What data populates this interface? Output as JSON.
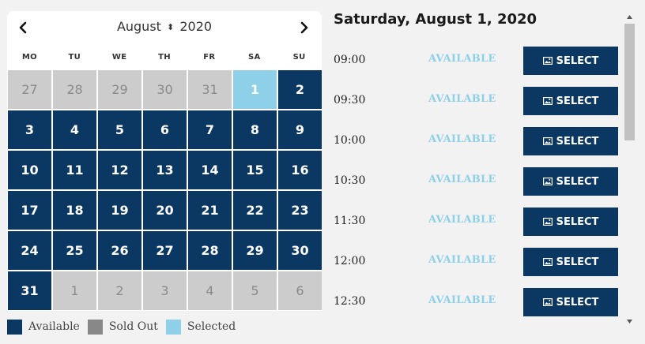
{
  "calendar": {
    "month": "August",
    "year": "2020",
    "month_toggle_glyph": "⬍",
    "prev_icon": "chevron-left-icon",
    "next_icon": "chevron-right-icon",
    "weekdays": [
      "MO",
      "TU",
      "WE",
      "TH",
      "FR",
      "SA",
      "SU"
    ],
    "weeks": [
      [
        {
          "day": "27",
          "state": "disabled"
        },
        {
          "day": "28",
          "state": "disabled"
        },
        {
          "day": "29",
          "state": "disabled"
        },
        {
          "day": "30",
          "state": "disabled"
        },
        {
          "day": "31",
          "state": "disabled"
        },
        {
          "day": "1",
          "state": "selected"
        },
        {
          "day": "2",
          "state": "available"
        }
      ],
      [
        {
          "day": "3",
          "state": "available"
        },
        {
          "day": "4",
          "state": "available"
        },
        {
          "day": "5",
          "state": "available"
        },
        {
          "day": "6",
          "state": "available"
        },
        {
          "day": "7",
          "state": "available"
        },
        {
          "day": "8",
          "state": "available"
        },
        {
          "day": "9",
          "state": "available"
        }
      ],
      [
        {
          "day": "10",
          "state": "available"
        },
        {
          "day": "11",
          "state": "available"
        },
        {
          "day": "12",
          "state": "available"
        },
        {
          "day": "13",
          "state": "available"
        },
        {
          "day": "14",
          "state": "available"
        },
        {
          "day": "15",
          "state": "available"
        },
        {
          "day": "16",
          "state": "available"
        }
      ],
      [
        {
          "day": "17",
          "state": "available"
        },
        {
          "day": "18",
          "state": "available"
        },
        {
          "day": "19",
          "state": "available"
        },
        {
          "day": "20",
          "state": "available"
        },
        {
          "day": "21",
          "state": "available"
        },
        {
          "day": "22",
          "state": "available"
        },
        {
          "day": "23",
          "state": "available"
        }
      ],
      [
        {
          "day": "24",
          "state": "available"
        },
        {
          "day": "25",
          "state": "available"
        },
        {
          "day": "26",
          "state": "available"
        },
        {
          "day": "27",
          "state": "available"
        },
        {
          "day": "28",
          "state": "available"
        },
        {
          "day": "29",
          "state": "available"
        },
        {
          "day": "30",
          "state": "available"
        }
      ],
      [
        {
          "day": "31",
          "state": "available"
        },
        {
          "day": "1",
          "state": "disabled"
        },
        {
          "day": "2",
          "state": "disabled"
        },
        {
          "day": "3",
          "state": "disabled"
        },
        {
          "day": "4",
          "state": "disabled"
        },
        {
          "day": "5",
          "state": "disabled"
        },
        {
          "day": "6",
          "state": "disabled"
        }
      ]
    ]
  },
  "legend": [
    {
      "label": "Available",
      "color": "#0b3763"
    },
    {
      "label": "Sold Out",
      "color": "#888888"
    },
    {
      "label": "Selected",
      "color": "#8dd0e8"
    }
  ],
  "day_title": "Saturday, August 1, 2020",
  "slots": [
    {
      "time": "09:00",
      "status": "AVAILABLE",
      "button": "SELECT"
    },
    {
      "time": "09:30",
      "status": "AVAILABLE",
      "button": "SELECT"
    },
    {
      "time": "10:00",
      "status": "AVAILABLE",
      "button": "SELECT"
    },
    {
      "time": "10:30",
      "status": "AVAILABLE",
      "button": "SELECT"
    },
    {
      "time": "11:30",
      "status": "AVAILABLE",
      "button": "SELECT"
    },
    {
      "time": "12:00",
      "status": "AVAILABLE",
      "button": "SELECT"
    },
    {
      "time": "12:30",
      "status": "AVAILABLE",
      "button": "SELECT"
    }
  ],
  "select_icon": "image-icon",
  "colors": {
    "available": "#0b3763",
    "selected": "#8dd0e8",
    "disabled": "#cccccc"
  }
}
